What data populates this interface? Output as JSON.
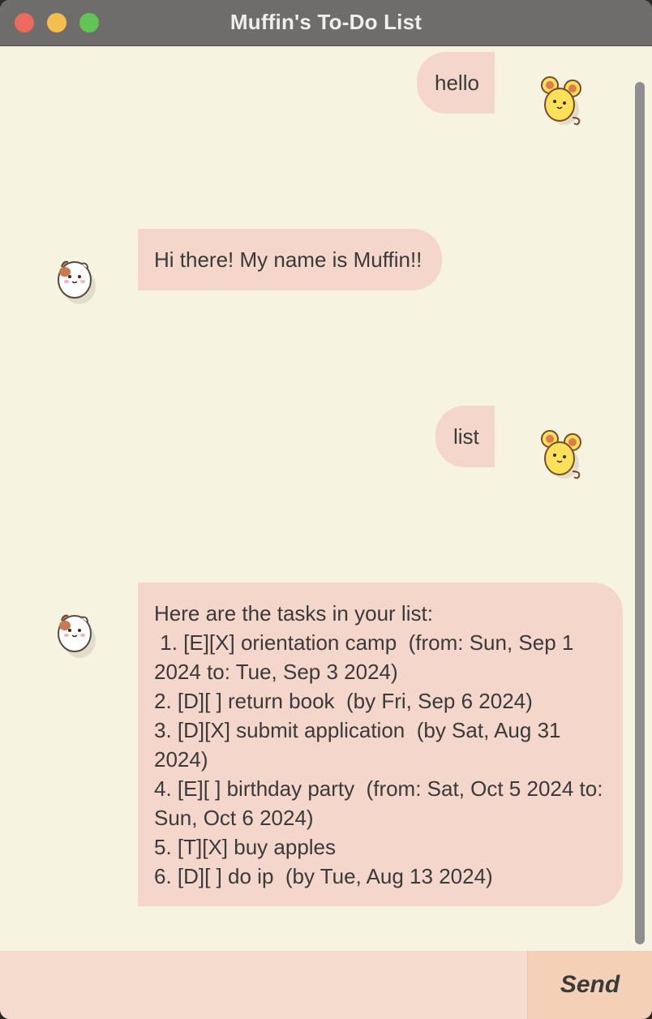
{
  "window": {
    "title": "Muffin's To-Do List"
  },
  "messages": [
    {
      "sender": "user",
      "text": "hello",
      "avatar": "yellow-mouse-icon"
    },
    {
      "sender": "bot",
      "text": "Hi there! My name is Muffin!!",
      "avatar": "white-hamster-icon"
    },
    {
      "sender": "user",
      "text": "list",
      "avatar": "yellow-mouse-icon"
    },
    {
      "sender": "bot",
      "text": "Here are the tasks in your list:\n 1. [E][X] orientation camp  (from: Sun, Sep 1 2024 to: Tue, Sep 3 2024)\n2. [D][ ] return book  (by Fri, Sep 6 2024)\n3. [D][X] submit application  (by Sat, Aug 31 2024)\n4. [E][ ] birthday party  (from: Sat, Oct 5 2024 to: Sun, Oct 6 2024)\n5. [T][X] buy apples\n6. [D][ ] do ip  (by Tue, Aug 13 2024)",
      "avatar": "white-hamster-icon"
    }
  ],
  "input": {
    "value": "",
    "placeholder": ""
  },
  "send_button": {
    "label": "Send"
  },
  "colors": {
    "background": "#f7f3e1",
    "bubble": "#f4d6cb",
    "titlebar": "#6e6d6b",
    "input": "#f6dccf",
    "send": "#f4d0b6"
  }
}
